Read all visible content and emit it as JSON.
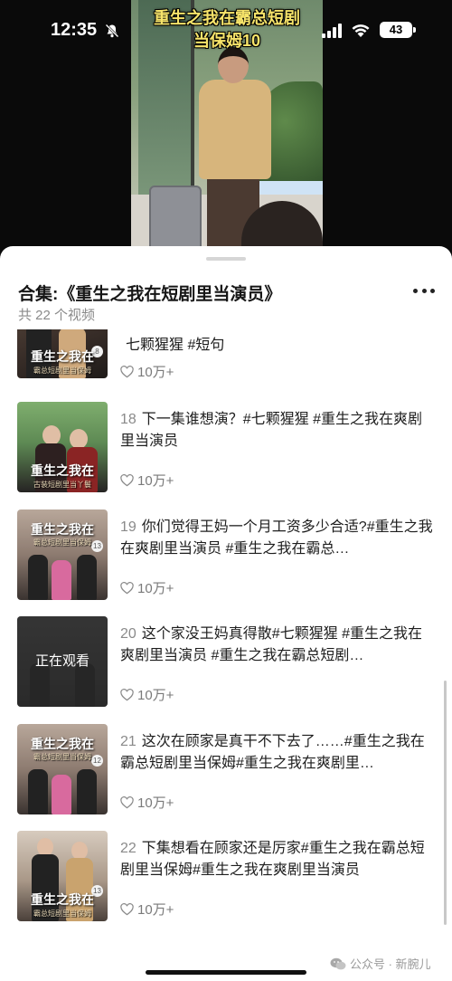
{
  "status_bar": {
    "time": "12:35",
    "battery": "43"
  },
  "video": {
    "overlay_line1": "重生之我在霸总短剧",
    "overlay_line2": "当保姆10"
  },
  "sheet": {
    "title": "合集:《重生之我在短剧里当演员》",
    "count": "共 22 个视频"
  },
  "thumb_caption": "重生之我在",
  "thumb_subs": [
    "霸总短剧里当保姆",
    "古装短剧里当丫鬟",
    "霸总短剧里当保姆",
    "",
    "霸总短剧里当保姆",
    "霸总短剧里当保姆"
  ],
  "episode_badges": [
    "8",
    "",
    "13",
    "",
    "12",
    "13"
  ],
  "now_watching": "正在观看",
  "items": [
    {
      "num": "",
      "title": "七颗猩猩 #短句",
      "likes": "10万+"
    },
    {
      "num": "18",
      "title": "下一集谁想演？#七颗猩猩 #重生之我在爽剧里当演员",
      "likes": "10万+"
    },
    {
      "num": "19",
      "title": "你们觉得王妈一个月工资多少合适?#重生之我在爽剧里当演员 #重生之我在霸总…",
      "likes": "10万+"
    },
    {
      "num": "20",
      "title": "这个家没王妈真得散#七颗猩猩 #重生之我在爽剧里当演员 #重生之我在霸总短剧…",
      "likes": "10万+"
    },
    {
      "num": "21",
      "title": "这次在顾家是真干不下去了……#重生之我在霸总短剧里当保姆#重生之我在爽剧里…",
      "likes": "10万+"
    },
    {
      "num": "22",
      "title": "下集想看在顾家还是厉家#重生之我在霸总短剧里当保姆#重生之我在爽剧里当演员",
      "likes": "10万+"
    }
  ],
  "watermark": "公众号 · 新腕儿",
  "icons": [
    "bell-slash-icon",
    "signal-icon",
    "wifi-icon",
    "more-icon",
    "heart-icon",
    "wechat-icon"
  ],
  "colors": {
    "overlay_text": "#f7e46a",
    "sheet_bg": "#ffffff",
    "muted_text": "#8a8a8a"
  }
}
